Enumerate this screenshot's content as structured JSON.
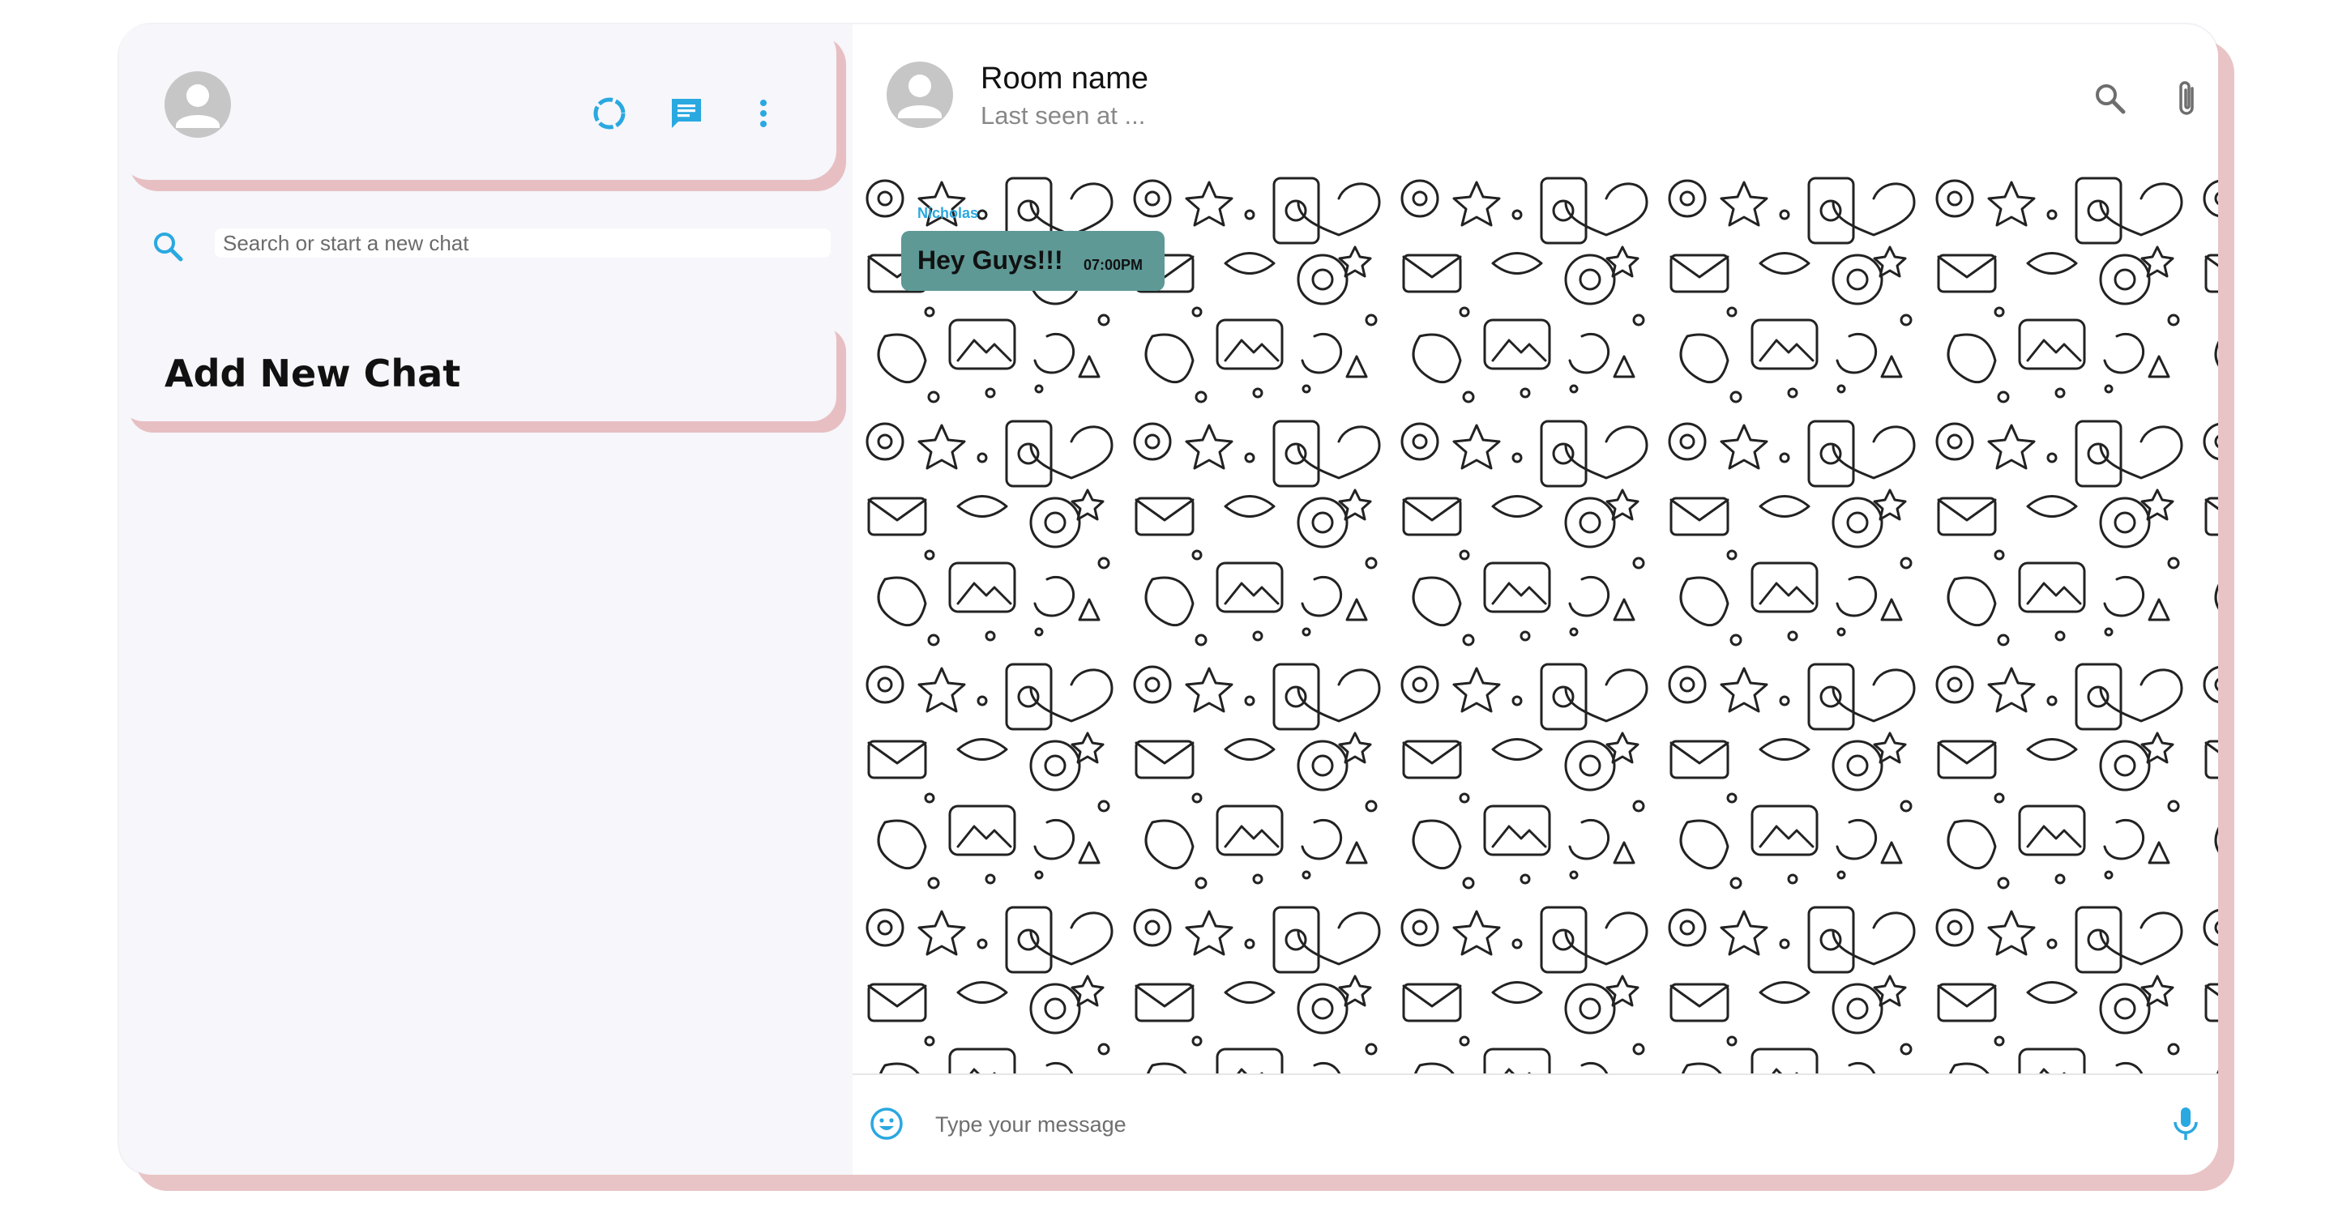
{
  "sidebar": {
    "search": {
      "placeholder": "Search or start a new chat"
    },
    "add_new_chat_label": "Add New Chat"
  },
  "chat": {
    "room_name": "Room name",
    "last_seen": "Last seen at ...",
    "messages": [
      {
        "sender": "Nicholas",
        "text": "Hey Guys!!!",
        "timestamp": "07:00PM"
      }
    ],
    "input": {
      "placeholder": "Type your message"
    }
  },
  "icons": {
    "sidebar_header": [
      "avatar-icon",
      "status-icon",
      "chat-icon",
      "more-vert-icon"
    ],
    "chat_header": [
      "search-icon",
      "attach-file-icon",
      "more-vert-icon"
    ],
    "footer": [
      "emoji-icon",
      "mic-icon"
    ]
  },
  "colors": {
    "accent": "#2aa8e0",
    "bubble": "#5e9996",
    "shadow": "#e7bfc2",
    "sidebar_bg": "#f6f6fb"
  }
}
